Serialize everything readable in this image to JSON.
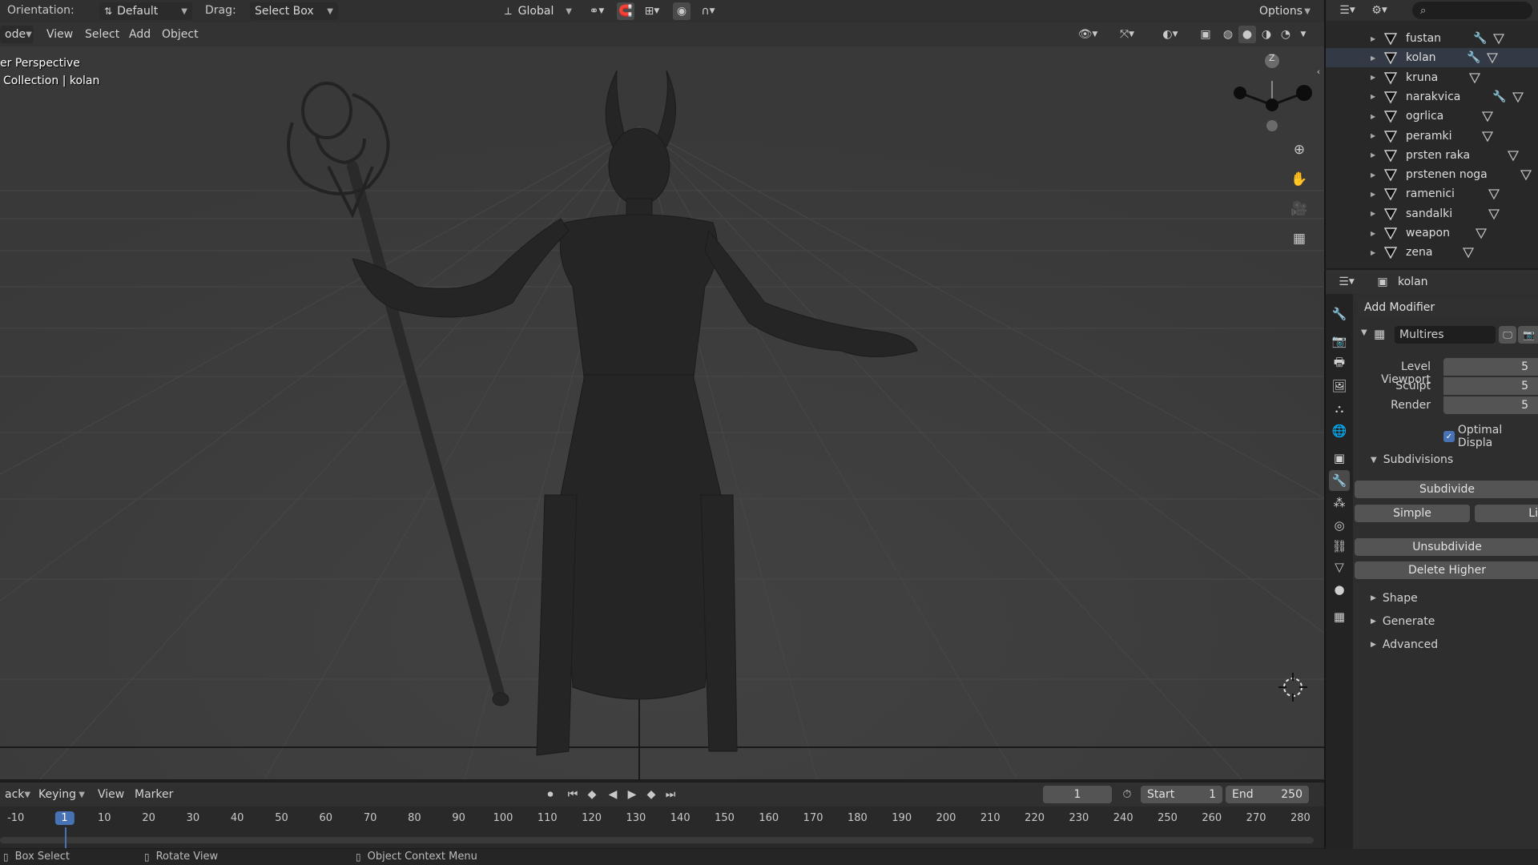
{
  "top_header": {
    "orientation_label": "Orientation:",
    "orientation_value": "Default",
    "drag_label": "Drag:",
    "drag_value": "Select Box",
    "transform_orientation": "Global",
    "options_label": "Options"
  },
  "viewport_header": {
    "mode_fragment": "ode",
    "menus": [
      "View",
      "Select",
      "Add",
      "Object"
    ]
  },
  "viewport": {
    "perspective_text": "er Perspective",
    "collection_text": "Collection | kolan",
    "gizmo_axis_label": "Z"
  },
  "timeline": {
    "playback_fragment": "ack",
    "menus": [
      "Keying",
      "View",
      "Marker"
    ],
    "current_frame": "1",
    "start_label": "Start",
    "start_value": "1",
    "end_label": "End",
    "end_value": "250",
    "ticks": [
      "-10",
      "1",
      "10",
      "20",
      "30",
      "40",
      "50",
      "60",
      "70",
      "80",
      "90",
      "100",
      "110",
      "120",
      "130",
      "140",
      "150",
      "160",
      "170",
      "180",
      "190",
      "200",
      "210",
      "220",
      "230",
      "240",
      "250",
      "260",
      "270",
      "280"
    ]
  },
  "statusbar": {
    "left": "Box Select",
    "middle": "Rotate View",
    "right": "Object Context Menu"
  },
  "outliner": {
    "items": [
      {
        "name": "fustan",
        "has_modifier": true
      },
      {
        "name": "kolan",
        "has_modifier": true
      },
      {
        "name": "kruna",
        "has_modifier": false
      },
      {
        "name": "narakvica",
        "has_modifier": true
      },
      {
        "name": "ogrlica",
        "has_modifier": false
      },
      {
        "name": "peramki",
        "has_modifier": false
      },
      {
        "name": "prsten raka",
        "has_modifier": false
      },
      {
        "name": "prstenen noga",
        "has_modifier": false
      },
      {
        "name": "ramenici",
        "has_modifier": false
      },
      {
        "name": "sandalki",
        "has_modifier": false
      },
      {
        "name": "weapon",
        "has_modifier": false
      },
      {
        "name": "zena",
        "has_modifier": false
      }
    ]
  },
  "properties": {
    "object_name": "kolan",
    "add_modifier": "Add Modifier",
    "modifier_name": "Multires",
    "level_viewport_label": "Level Viewport",
    "level_viewport_value": "5",
    "sculpt_label": "Sculpt",
    "sculpt_value": "5",
    "render_label": "Render",
    "render_value": "5",
    "optimal_display": "Optimal Displa",
    "subdivisions_label": "Subdivisions",
    "subdivide_btn": "Subdivide",
    "simple_btn": "Simple",
    "linear_btn_fragment": "Li",
    "unsubdivide_btn": "Unsubdivide",
    "delete_higher_btn": "Delete Higher",
    "panels": [
      "Shape",
      "Generate",
      "Advanced"
    ]
  },
  "colors": {
    "viewport_bg": "#3d3d3d",
    "header_bg": "#303030",
    "accent": "#4772b3"
  }
}
